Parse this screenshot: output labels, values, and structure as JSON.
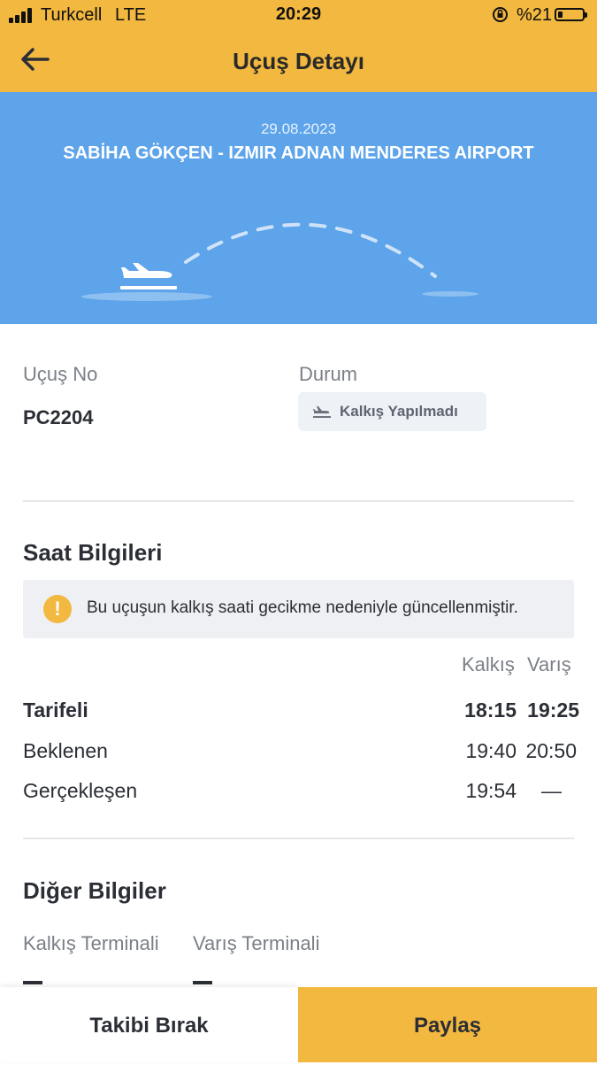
{
  "status_bar": {
    "carrier": "Turkcell",
    "network": "LTE",
    "time": "20:29",
    "battery": "%21",
    "battery_level": 0.21
  },
  "header": {
    "back_icon": "arrow-left-icon",
    "title": "Uçuş Detayı",
    "color": "#f2b83f"
  },
  "hero": {
    "date": "29.08.2023",
    "route": "SABİHA GÖKÇEN - IZMIR ADNAN MENDERES AIRPORT",
    "color": "#5da4ea",
    "icon": "plane-takeoff-icon"
  },
  "flight": {
    "no_label": "Uçuş No",
    "no_value": "PC2204",
    "status_label": "Durum",
    "status_value": "Kalkış Yapılmadı",
    "status_icon": "plane-icon"
  },
  "times": {
    "section_title": "Saat Bilgileri",
    "alert_icon": "warning-icon",
    "alert_text": "Bu uçuşun kalkış saati gecikme nedeniyle güncellenmiştir.",
    "col_departure": "Kalkış",
    "col_arrival": "Varış",
    "rows": [
      {
        "label": "Tarifeli",
        "departure": "18:15",
        "arrival": "19:25"
      },
      {
        "label": "Beklenen",
        "departure": "19:40",
        "arrival": "20:50"
      },
      {
        "label": "Gerçekleşen",
        "departure": "19:54",
        "arrival": "—"
      }
    ]
  },
  "other": {
    "section_title": "Diğer Bilgiler",
    "dep_terminal_label": "Kalkış Terminali",
    "arr_terminal_label": "Varış Terminali",
    "dep_terminal_value": "—",
    "arr_terminal_value": "—"
  },
  "actions": {
    "unfollow": "Takibi Bırak",
    "share": "Paylaş"
  }
}
